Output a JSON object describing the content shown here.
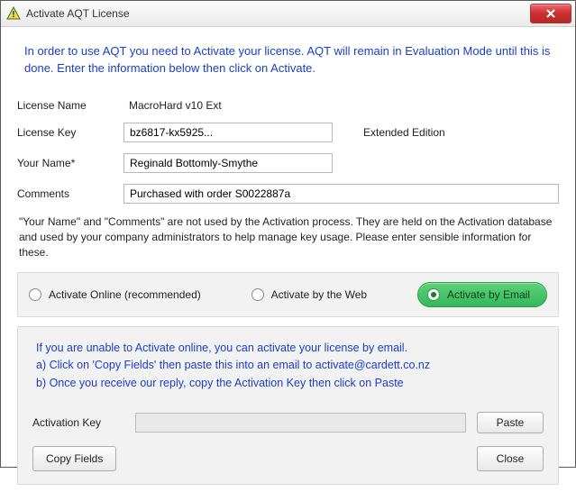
{
  "window": {
    "title": "Activate AQT License"
  },
  "intro": "In order to use AQT you need to Activate your license. AQT will remain in Evaluation Mode until this is done. Enter the information below then click on Activate.",
  "fields": {
    "license_name_label": "License Name",
    "license_name_value": "MacroHard v10 Ext",
    "license_key_label": "License Key",
    "license_key_value": "bz6817-kx5925...",
    "edition_label": "Extended Edition",
    "your_name_label": "Your Name*",
    "your_name_value": "Reginald Bottomly-Smythe",
    "comments_label": "Comments",
    "comments_value": "Purchased with order S0022887a"
  },
  "note": "\"Your Name\" and \"Comments\" are not used by the Activation process. They are held on the Activation database and used by your company administrators to help manage key usage. Please enter sensible information for these.",
  "options": {
    "online": "Activate Online (recommended)",
    "web": "Activate by the Web",
    "email": "Activate by Email",
    "selected": "email"
  },
  "email_panel": {
    "line1": "If you are unable to Activate online, you can activate your license by email.",
    "line2": "a) Click on 'Copy Fields' then paste this into an email to activate@cardett.co.nz",
    "line3": "b) Once you receive our reply, copy the Activation Key then click on Paste",
    "activation_key_label": "Activation Key",
    "activation_key_value": "",
    "paste_label": "Paste",
    "copy_fields_label": "Copy Fields",
    "close_label": "Close"
  }
}
